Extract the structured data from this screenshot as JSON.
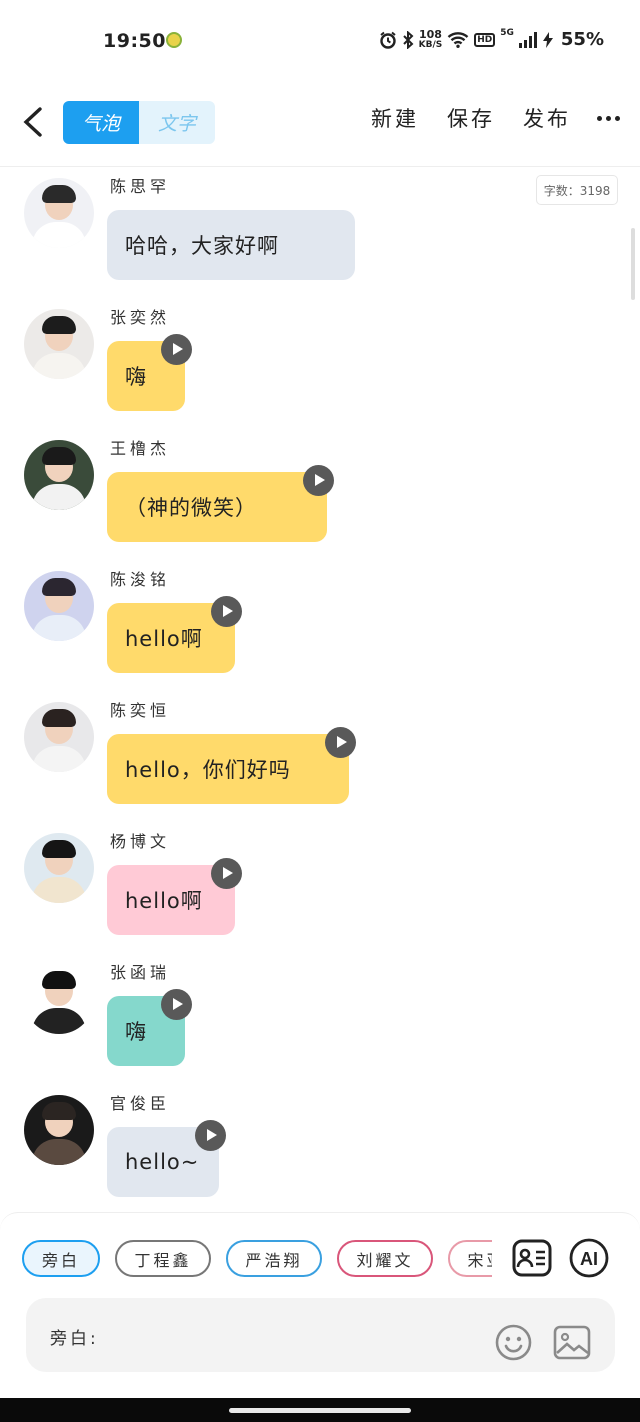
{
  "status_bar": {
    "time": "19:50",
    "network_speed_value": "108",
    "network_speed_unit": "KB/S",
    "hd_label": "HD",
    "network_type": "5G",
    "battery": "55%",
    "icons": [
      "alarm-icon",
      "bluetooth-icon",
      "wifi-icon",
      "signal-icon",
      "charging-icon"
    ]
  },
  "toolbar": {
    "mode_bubble": "气泡",
    "mode_text": "文字",
    "new_label": "新建",
    "save_label": "保存",
    "publish_label": "发布",
    "more_icon": "more-dots-icon"
  },
  "word_count": "字数：3198",
  "messages": [
    {
      "name": "陈思罕",
      "text": "哈哈，大家好啊",
      "color": "#e1e7ef",
      "voice": false
    },
    {
      "name": "张奕然",
      "text": "嗨",
      "color": "#ffda6b",
      "voice": true
    },
    {
      "name": "王橹杰",
      "text": "（神的微笑）",
      "color": "#ffda6b",
      "voice": true
    },
    {
      "name": "陈浚铭",
      "text": "hello啊",
      "color": "#ffda6b",
      "voice": true
    },
    {
      "name": "陈奕恒",
      "text": "hello，你们好吗",
      "color": "#ffda6b",
      "voice": true
    },
    {
      "name": "杨博文",
      "text": "hello啊",
      "color": "#ffcad6",
      "voice": true
    },
    {
      "name": "张函瑞",
      "text": "嗨",
      "color": "#85d8cc",
      "voice": true
    },
    {
      "name": "官俊臣",
      "text": "hello~",
      "color": "#e1e7ef",
      "voice": true
    }
  ],
  "speakers": [
    "旁白",
    "丁程鑫",
    "严浩翔",
    "刘耀文",
    "宋亚轩"
  ],
  "speaker_colors": [
    "#1d9ff0",
    "#777777",
    "#3aa0e0",
    "#d9567a",
    "#e89aa8"
  ],
  "input": {
    "label": "旁白:",
    "ai_label": "AI",
    "icons": [
      "contact-card-icon",
      "emoji-icon",
      "image-icon"
    ]
  },
  "colors": {
    "accent": "#1d9ff0",
    "yellow_bubble": "#ffda6b",
    "gray_bubble": "#e1e7ef",
    "pink_bubble": "#ffcad6",
    "teal_bubble": "#85d8cc"
  }
}
